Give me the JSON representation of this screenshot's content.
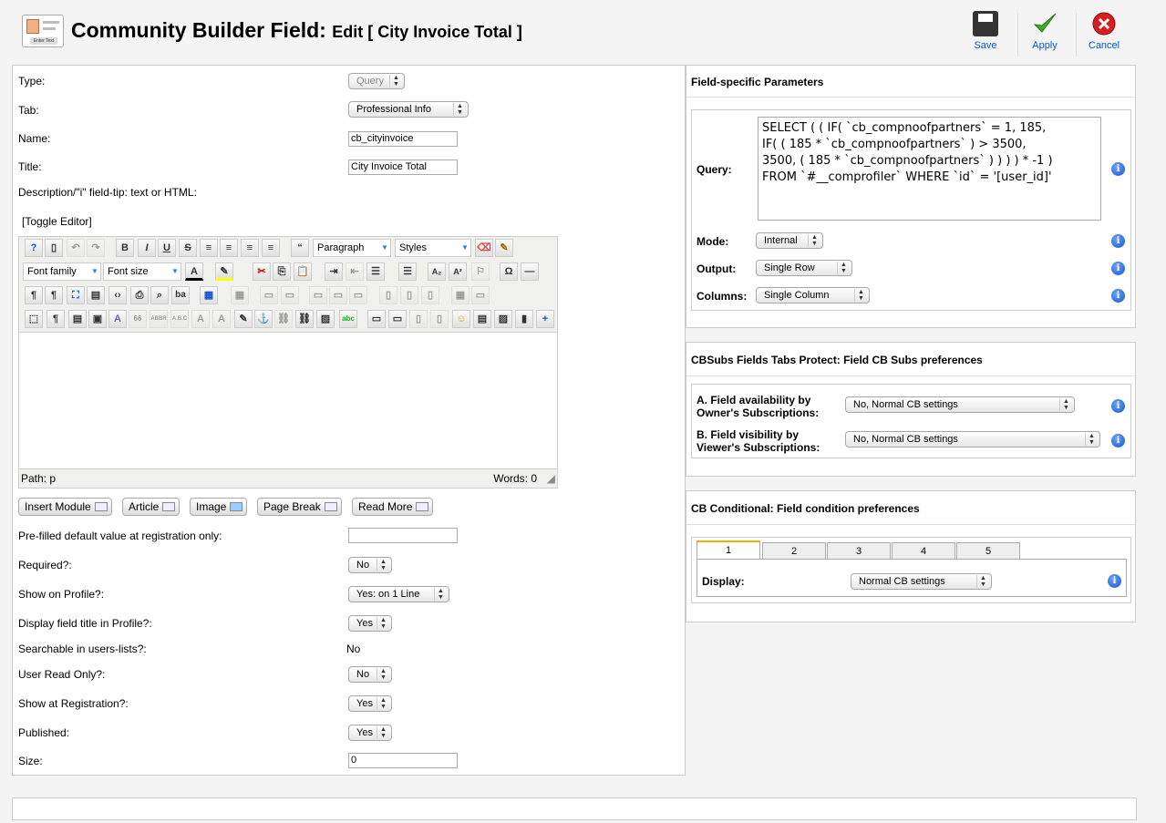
{
  "header": {
    "title": "Community Builder Field:",
    "subtitle": "Edit [ City Invoice Total ]",
    "logo_text": "Enter Text",
    "buttons": [
      {
        "label": "Save",
        "icon": "floppy-disk-icon"
      },
      {
        "label": "Apply",
        "icon": "checkmark-icon"
      },
      {
        "label": "Cancel",
        "icon": "cancel-icon"
      }
    ]
  },
  "left": {
    "type_label": "Type:",
    "type_value": "Query",
    "tab_label": "Tab:",
    "tab_value": "Professional Info",
    "name_label": "Name:",
    "name_value": "cb_cityinvoice",
    "title_label": "Title:",
    "title_value": "City Invoice Total",
    "desc_label": "Description/\"i\" field-tip: text or HTML:",
    "toggle_editor": "[Toggle Editor]",
    "editor": {
      "format_select": "Paragraph",
      "styles_select": "Styles",
      "font_family": "Font family",
      "font_size": "Font size",
      "path": "Path:  p",
      "words": "Words: 0"
    },
    "buttons": [
      "Insert Module",
      "Article",
      "Image",
      "Page Break",
      "Read More"
    ],
    "prefilled_label": "Pre-filled default value at registration only:",
    "prefilled_value": "",
    "required_label": "Required?:",
    "required_value": "No",
    "show_profile_label": "Show on Profile?:",
    "show_profile_value": "Yes: on 1 Line",
    "display_title_label": "Display field title in Profile?:",
    "display_title_value": "Yes",
    "searchable_label": "Searchable in users-lists?:",
    "searchable_value": "No",
    "read_only_label": "User Read Only?:",
    "read_only_value": "No",
    "show_reg_label": "Show at Registration?:",
    "show_reg_value": "Yes",
    "published_label": "Published:",
    "published_value": "Yes",
    "size_label": "Size:",
    "size_value": "0"
  },
  "field_params": {
    "title": "Field-specific Parameters",
    "query_label": "Query:",
    "query_value": "SELECT ( ( IF( `cb_compnoofpartners` = 1, 185,\nIF( ( 185 * `cb_compnoofpartners` ) > 3500,\n3500, ( 185 * `cb_compnoofpartners` ) ) ) ) * -1 )\nFROM `#__comprofiler` WHERE `id` = '[user_id]'",
    "mode_label": "Mode:",
    "mode_value": "Internal",
    "output_label": "Output:",
    "output_value": "Single Row",
    "columns_label": "Columns:",
    "columns_value": "Single Column"
  },
  "cbsubs": {
    "title": "CBSubs Fields Tabs Protect: Field CB Subs preferences",
    "a_label_1": "A. Field availability by",
    "a_label_2": "Owner's Subscriptions:",
    "a_value": "No, Normal CB settings",
    "b_label_1": "B. Field visibility by",
    "b_label_2": "Viewer's Subscriptions:",
    "b_value": "No, Normal CB settings"
  },
  "conditional": {
    "title": "CB Conditional: Field condition preferences",
    "tabs": [
      "1",
      "2",
      "3",
      "4",
      "5"
    ],
    "display_label": "Display:",
    "display_value": "Normal CB settings"
  },
  "colors": {
    "link_blue": "#0b55c4",
    "info_blue": "#1553c5",
    "active_tab": "#f0b000"
  }
}
